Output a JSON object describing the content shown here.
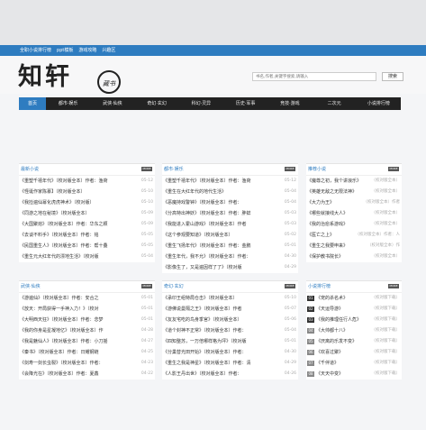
{
  "top_links": [
    "全职小说排行榜",
    "ppt模板",
    "游戏攻略",
    "兴趣区"
  ],
  "logo": {
    "text": "知轩",
    "seal": "藏书"
  },
  "search": {
    "placeholder": "书名,作者,关键字搜索,请输入",
    "button": "搜索"
  },
  "nav": [
    "首页",
    "都市·娱乐",
    "武侠·仙侠",
    "奇幻·玄幻",
    "科幻·灵异",
    "历史·军事",
    "竞技·游戏",
    "二次元",
    "小说排行榜"
  ],
  "more_label": "MORE",
  "panels": [
    {
      "title": "最新小说",
      "rows": [
        {
          "t": "《重塑千禧年代》（校对版全本）作者：渔荷",
          "d": "05-12"
        },
        {
          "t": "《怪诞作家陈慕】（校对版全本）",
          "d": "05-10"
        },
        {
          "t": "《我捡遍仙幂化虎虎神术》（校对版）",
          "d": "05-10"
        },
        {
          "t": "《同游之地在秘境》（校对版全本）",
          "d": "05-09"
        },
        {
          "t": "《大国聚熔》（校对版全本）作者：华东之颖",
          "d": "05-09"
        },
        {
          "t": "《去谈不料手》（校对版全本）作者：铭",
          "d": "05-05"
        },
        {
          "t": "《民国重生人》（校对版全本）作者：帮十叠",
          "d": "05-05"
        },
        {
          "t": "《重生元大红年代的漂地生活》（校对版",
          "d": "05-04"
        }
      ]
    },
    {
      "title": "都市·娱乐",
      "rows": [
        {
          "t": "《重塑千禧年代》（校对版全本）作者：渔荷",
          "d": "05-12"
        },
        {
          "t": "《重生在大红年代的地代生活》",
          "d": "05-04"
        },
        {
          "t": "《恶魔持戏警钟》（校对版全本）作者：",
          "d": "05-04"
        },
        {
          "t": "《分高特出神妖》（校对版全本）作者：胖蚌",
          "d": "05-03"
        },
        {
          "t": "《我能进入霍山游戏》（校对版全本）作者",
          "d": "05-03"
        },
        {
          "t": "《这个参观要知道》（校对版全本）",
          "d": "05-02"
        },
        {
          "t": "《重生飞扬年代》（校对版全本）作者：金鹏",
          "d": "05-01"
        },
        {
          "t": "《重生年代，我不允》（校对版全本）作者：",
          "d": "04-30"
        },
        {
          "t": "《影像生了，又是遍因样了了》（校对版",
          "d": "04-29"
        }
      ]
    },
    {
      "title": "推荐小说",
      "rows": [
        {
          "t": "《魔尊之初，我个讲浪乐》",
          "d": "（校对版全本）"
        },
        {
          "t": "《英雄无敌之无限法神》",
          "d": "（校对版全本）"
        },
        {
          "t": "《大力为王》",
          "d": "（校对版全本）作者"
        },
        {
          "t": "《哪些就接线大人》",
          "d": "（校对版全本）"
        },
        {
          "t": "《我的治愈系游戏》",
          "d": "（校对版全本）"
        },
        {
          "t": "《医亡之上》",
          "d": "（校对版全本）作者：人"
        },
        {
          "t": "《重生之我要申来》",
          "d": "（校对版全本）作"
        },
        {
          "t": "《保护教书院长》",
          "d": "（校对版全本）"
        }
      ]
    },
    {
      "title": "武侠·仙侠",
      "rows": [
        {
          "t": "《游遍仙》（校对版全本）作者：安合之",
          "d": "05-01"
        },
        {
          "t": "《放天：开局获得一手神入力！》（校对",
          "d": "05-01"
        },
        {
          "t": "《大明西天狂》（校对版全本）作者：念梦",
          "d": "05-01"
        },
        {
          "t": "《我的你身是星凝地亿》（校对版全本）作",
          "d": "04-28"
        },
        {
          "t": "《我是魅仙人》（校对版全本）作者：小刀摇",
          "d": "04-27"
        },
        {
          "t": "《秦书》（校对版全本）作者：日耀钢链",
          "d": "04-25"
        },
        {
          "t": "《剑寿一剑长虫裂》（校对版全本）作者：",
          "d": "04-23"
        },
        {
          "t": "《会降光在》（校对版全本）作者：夏鑫",
          "d": "04-22"
        }
      ]
    },
    {
      "title": "奇幻·玄幻",
      "rows": [
        {
          "t": "《承印王组特局仓击》（校对版全本）",
          "d": "05-10"
        },
        {
          "t": "《游佛说曼隔之王》（校对版全本）作者",
          "d": "05-07"
        },
        {
          "t": "《友友宅吃的鸟身季官》（校对版全本）",
          "d": "05-06"
        },
        {
          "t": "《道个封神不正常》（校对版全本）作者：",
          "d": "05-04"
        },
        {
          "t": "《四知整苏，一万倍哪样格为坪》（校对版",
          "d": "05-01"
        },
        {
          "t": "《分巢替光田开始》（校对版全本）作者：",
          "d": "04-30"
        },
        {
          "t": "《重生之我是神星》（校对版全本）作者：清",
          "d": "04-29"
        },
        {
          "t": "《人影王丹出世》（校对版全本）作者：",
          "d": "04-26"
        }
      ]
    },
    {
      "title": "小说排行榜",
      "rows": [
        {
          "n": "01",
          "t": "《宠的杀名术》",
          "d": "（校对版下载）"
        },
        {
          "n": "02",
          "t": "《天运导游》",
          "d": "（校对版下载）"
        },
        {
          "n": "03",
          "t": "《我的推理任行人危》",
          "d": "（校对版下载）"
        },
        {
          "n": "04",
          "t": "《大帅都十八》",
          "d": "（校对版下载）"
        },
        {
          "n": "05",
          "t": "《厌离的乐发不变》",
          "d": "（校对版下载）"
        },
        {
          "n": "06",
          "t": "《欢喜过聚》",
          "d": "（校对版下载）"
        },
        {
          "n": "07",
          "t": "《千伴道》",
          "d": "（校对版下载）"
        },
        {
          "n": "08",
          "t": "《天天中变》",
          "d": "（校对版下载）"
        }
      ]
    }
  ]
}
